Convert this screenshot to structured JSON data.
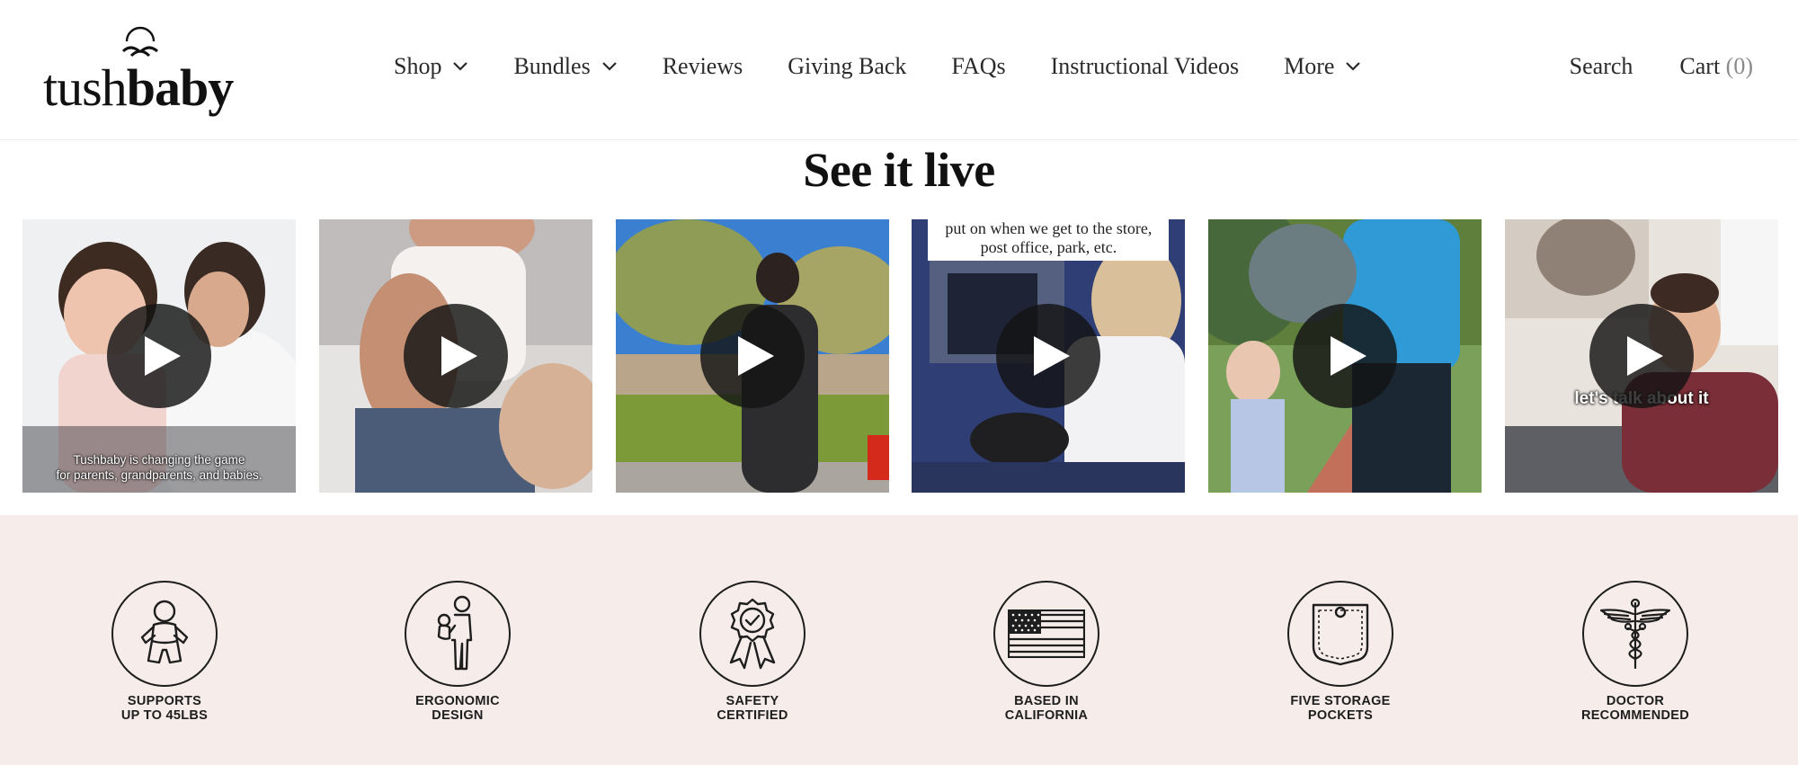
{
  "brand": {
    "name_light": "tush",
    "name_bold": "baby"
  },
  "nav": {
    "items": [
      {
        "label": "Shop",
        "has_dropdown": true
      },
      {
        "label": "Bundles",
        "has_dropdown": true
      },
      {
        "label": "Reviews",
        "has_dropdown": false
      },
      {
        "label": "Giving Back",
        "has_dropdown": false
      },
      {
        "label": "FAQs",
        "has_dropdown": false
      },
      {
        "label": "Instructional Videos",
        "has_dropdown": false
      },
      {
        "label": "More",
        "has_dropdown": true
      }
    ],
    "search_label": "Search",
    "cart_label": "Cart",
    "cart_count": "(0)"
  },
  "section": {
    "title": "See it live"
  },
  "videos": [
    {
      "caption_line1": "Tushbaby is changing the game",
      "caption_line2": "for parents, grandparents, and babies."
    },
    {},
    {},
    {
      "caption_top_line1": "put on when we get to the store,",
      "caption_top_line2": "post office, park, etc."
    },
    {},
    {
      "caption_bold": "let's talk about it"
    }
  ],
  "features": [
    {
      "line1": "SUPPORTS",
      "line2": "UP TO 45LBS",
      "icon": "baby-icon"
    },
    {
      "line1": "ERGONOMIC",
      "line2": "DESIGN",
      "icon": "parent-holding-baby-icon"
    },
    {
      "line1": "SAFETY",
      "line2": "CERTIFIED",
      "icon": "award-ribbon-check-icon"
    },
    {
      "line1": "BASED IN",
      "line2": "CALIFORNIA",
      "icon": "us-flag-icon"
    },
    {
      "line1": "FIVE STORAGE",
      "line2": "POCKETS",
      "icon": "pocket-icon"
    },
    {
      "line1": "DOCTOR",
      "line2": "RECOMMENDED",
      "icon": "caduceus-icon"
    }
  ],
  "colors": {
    "features_bg": "#f6ece9",
    "text": "#222222",
    "play_button": "#141414"
  }
}
